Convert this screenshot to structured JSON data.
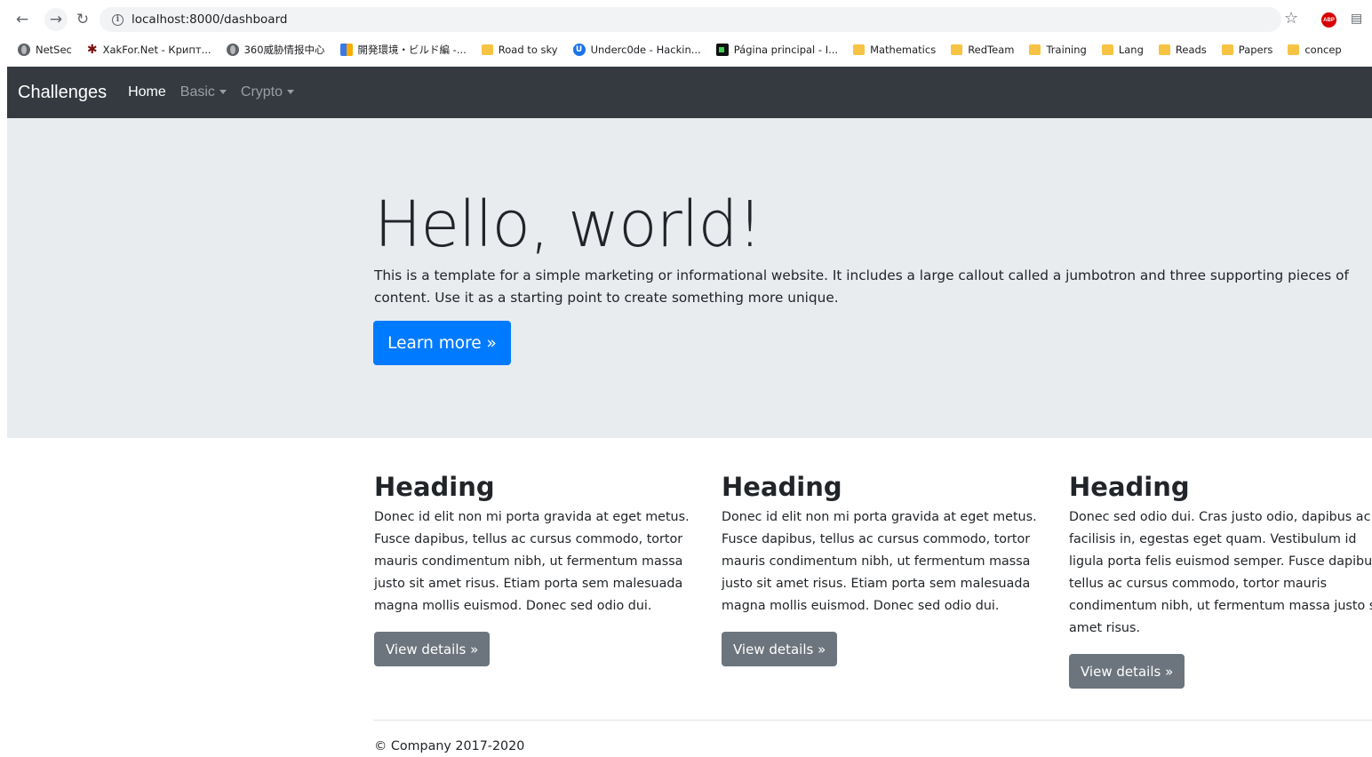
{
  "browser": {
    "url": "localhost:8000/dashboard",
    "bookmarks": [
      {
        "label": "NetSec",
        "icon": "globe"
      },
      {
        "label": "XakFor.Net - Крипт...",
        "icon": "star"
      },
      {
        "label": "360威胁情报中心",
        "icon": "globe"
      },
      {
        "label": "開発環境・ビルド編 -...",
        "icon": "blocks"
      },
      {
        "label": "Road to sky",
        "icon": "folder"
      },
      {
        "label": "Underc0de - Hackin...",
        "icon": "uc"
      },
      {
        "label": "Página principal - I...",
        "icon": "terminal"
      },
      {
        "label": "Mathematics",
        "icon": "folder"
      },
      {
        "label": "RedTeam",
        "icon": "folder"
      },
      {
        "label": "Training",
        "icon": "folder"
      },
      {
        "label": "Lang",
        "icon": "folder"
      },
      {
        "label": "Reads",
        "icon": "folder"
      },
      {
        "label": "Papers",
        "icon": "folder"
      },
      {
        "label": "concep",
        "icon": "folder"
      }
    ]
  },
  "navbar": {
    "brand": "Challenges",
    "home": "Home",
    "basic": "Basic",
    "crypto": "Crypto"
  },
  "jumbotron": {
    "title": "Hello, world!",
    "lead": "This is a template for a simple marketing or informational website. It includes a large callout called a jumbotron and three supporting pieces of content. Use it as a starting point to create something more unique.",
    "button": "Learn more »"
  },
  "columns": [
    {
      "heading": "Heading",
      "text": "Donec id elit non mi porta gravida at eget metus. Fusce dapibus, tellus ac cursus commodo, tortor mauris condimentum nibh, ut fermentum massa justo sit amet risus. Etiam porta sem malesuada magna mollis euismod. Donec sed odio dui.",
      "button": "View details »"
    },
    {
      "heading": "Heading",
      "text": "Donec id elit non mi porta gravida at eget metus. Fusce dapibus, tellus ac cursus commodo, tortor mauris condimentum nibh, ut fermentum massa justo sit amet risus. Etiam porta sem malesuada magna mollis euismod. Donec sed odio dui.",
      "button": "View details »"
    },
    {
      "heading": "Heading",
      "text": "Donec sed odio dui. Cras justo odio, dapibus ac facilisis in, egestas eget quam. Vestibulum id ligula porta felis euismod semper. Fusce dapibus, tellus ac cursus commodo, tortor mauris condimentum nibh, ut fermentum massa justo sit amet risus.",
      "button": "View details »"
    }
  ],
  "footer": "© Company 2017-2020",
  "colors": {
    "navbar_bg": "#343a40",
    "jumbotron_bg": "#e9ecef",
    "primary": "#007bff",
    "secondary": "#6c757d"
  }
}
